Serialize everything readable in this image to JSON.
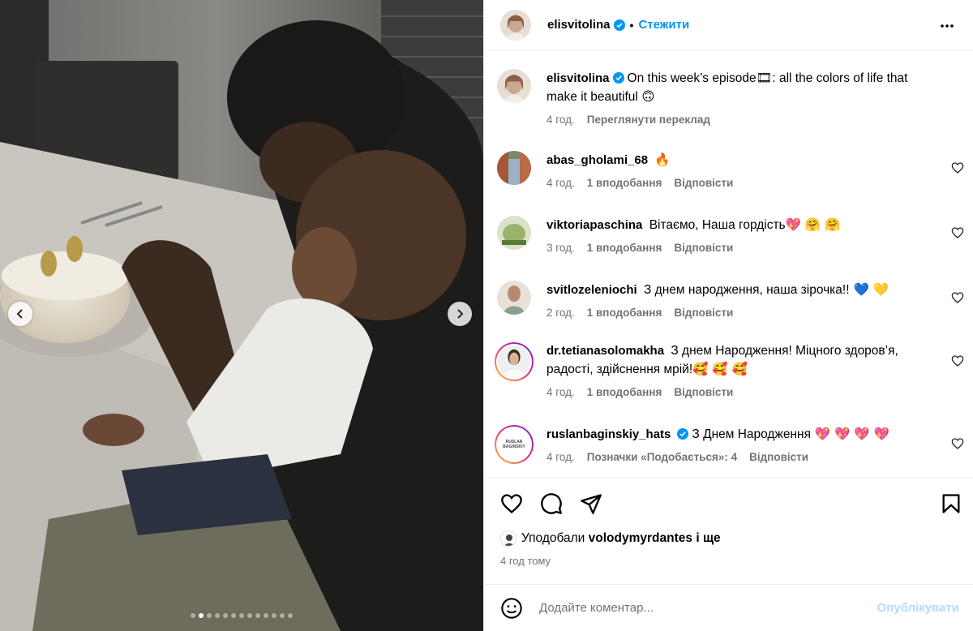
{
  "post": {
    "author": "elisvitolina",
    "follow_label": "Стежити",
    "separator": "•",
    "more_icon": "more-horizontal-icon"
  },
  "caption": {
    "author": "elisvitolina",
    "text_before": "On this week’s episode",
    "text_emoji": "🎞",
    "text_after": ": all the colors of life that make it beautiful ",
    "text_end_emoji": "🙃",
    "time": "4 год.",
    "translate_label": "Переглянути переклад"
  },
  "comments": [
    {
      "user": "abas_gholami_68",
      "text": "",
      "emoji": "🔥",
      "time": "4 год.",
      "likes": "1 вподобання",
      "reply": "Відповісти"
    },
    {
      "user": "viktoriapaschina",
      "text": "Вітаємо, Наша гордість",
      "emoji": "💖 🤗 🤗",
      "time": "3 год.",
      "likes": "1 вподобання",
      "reply": "Відповісти"
    },
    {
      "user": "svitlozeleniochi",
      "text": "З днем народження, наша зірочка!!",
      "emoji": " 💙 💛",
      "time": "2 год.",
      "likes": "1 вподобання",
      "reply": "Відповісти"
    },
    {
      "user": "dr.tetianasolomakha",
      "text": "З днем Народження! Міцного здоров’я, радості, здійснення мрій!",
      "emoji": "🥰 🥰 🥰",
      "time": "4 год.",
      "likes": "1 вподобання",
      "reply": "Відповісти"
    },
    {
      "user": "ruslanbaginskiy_hats",
      "text": "З Днем Народження",
      "emoji": " 💖 💖 💖 💖",
      "time": "4 год.",
      "likes": "Позначки «Подобається»: 4",
      "reply": "Відповісти"
    }
  ],
  "ruslan_avatar_text": "RUSLAN BAGINSKIY",
  "actions": {
    "like_icon": "heart-icon",
    "comment_icon": "comment-icon",
    "share_icon": "send-icon",
    "save_icon": "bookmark-icon"
  },
  "likes": {
    "prefix": "Уподобали",
    "user": "volodymyrdantes",
    "suffix": "і ще"
  },
  "time_ago": "4 год тому",
  "add_comment": {
    "placeholder": "Додайте коментар...",
    "publish_label": "Опублікувати"
  },
  "carousel": {
    "total_dots": 13,
    "active_index": 1
  }
}
